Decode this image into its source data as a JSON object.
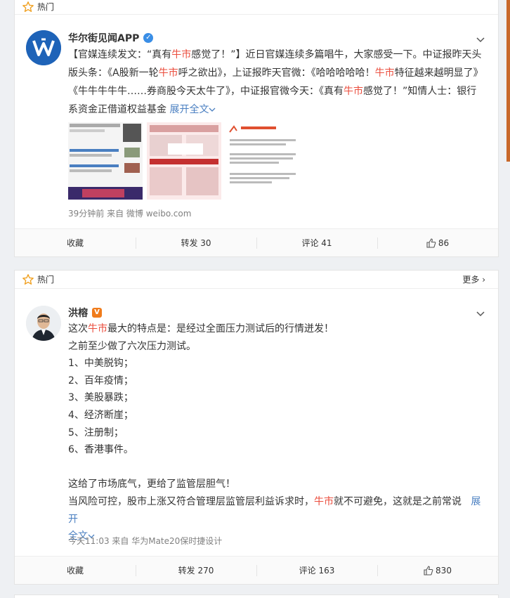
{
  "posts": [
    {
      "hot_label": "热门",
      "username": "华尔街见闻APP",
      "content": {
        "p1": "【官媒连续发文：“真有",
        "h1": "牛市",
        "p2": "感觉了！”】近日官媒连续多篇唱牛，大家感受一下。中证报昨天头版头条：《A股新一轮",
        "h2": "牛市",
        "p3": "呼之欲出》，上证报昨天官微：《哈哈哈哈哈！",
        "h3": "牛市",
        "p4": "特征越来越明显了》《牛牛牛牛牛……券商股今天太牛了》，中证报官微今天：《真有",
        "h4": "牛市",
        "p5": "感觉了！”知情人士：银行系资金正借道权益基金",
        "expand": "展开全文"
      },
      "meta": "39分钟前  来自 微博 weibo.com",
      "actions": {
        "collect": "收藏",
        "repost": "转发 30",
        "comment": "评论 41",
        "like": "86"
      }
    },
    {
      "hot_label": "热门",
      "more": "更多",
      "username": "洪榕",
      "content": {
        "l1a": "这次",
        "l1h": "牛市",
        "l1b": "最大的特点是：是经过全面压力测试后的行情迸发！",
        "l2": "之前至少做了六次压力测试。",
        "l3": "1、中美脱钩；",
        "l4": "2、百年疫情；",
        "l5": "3、美股暴跌；",
        "l6": "4、经济断崖；",
        "l7": "5、注册制；",
        "l8": "6、香港事件。",
        "l9": "这给了市场底气，更给了监管层胆气！",
        "l10a": "当风险可控，股市上涨又符合管理层监管层利益诉求时，",
        "l10h": "牛市",
        "l10b": "就不可避免，这就是之前常说",
        "expand1": "展开",
        "expand2": "全文"
      },
      "meta": "今天11:03  来自 华为Mate20保时捷设计",
      "actions": {
        "collect": "收藏",
        "repost": "转发 270",
        "comment": "评论 163",
        "like": "830"
      }
    }
  ],
  "colors": {
    "highlight": "#eb4d3d",
    "link": "#4a7fc1",
    "star": "#f0a020",
    "verified_blue": "#3a8ee6",
    "verified_orange": "#f07c1c"
  }
}
